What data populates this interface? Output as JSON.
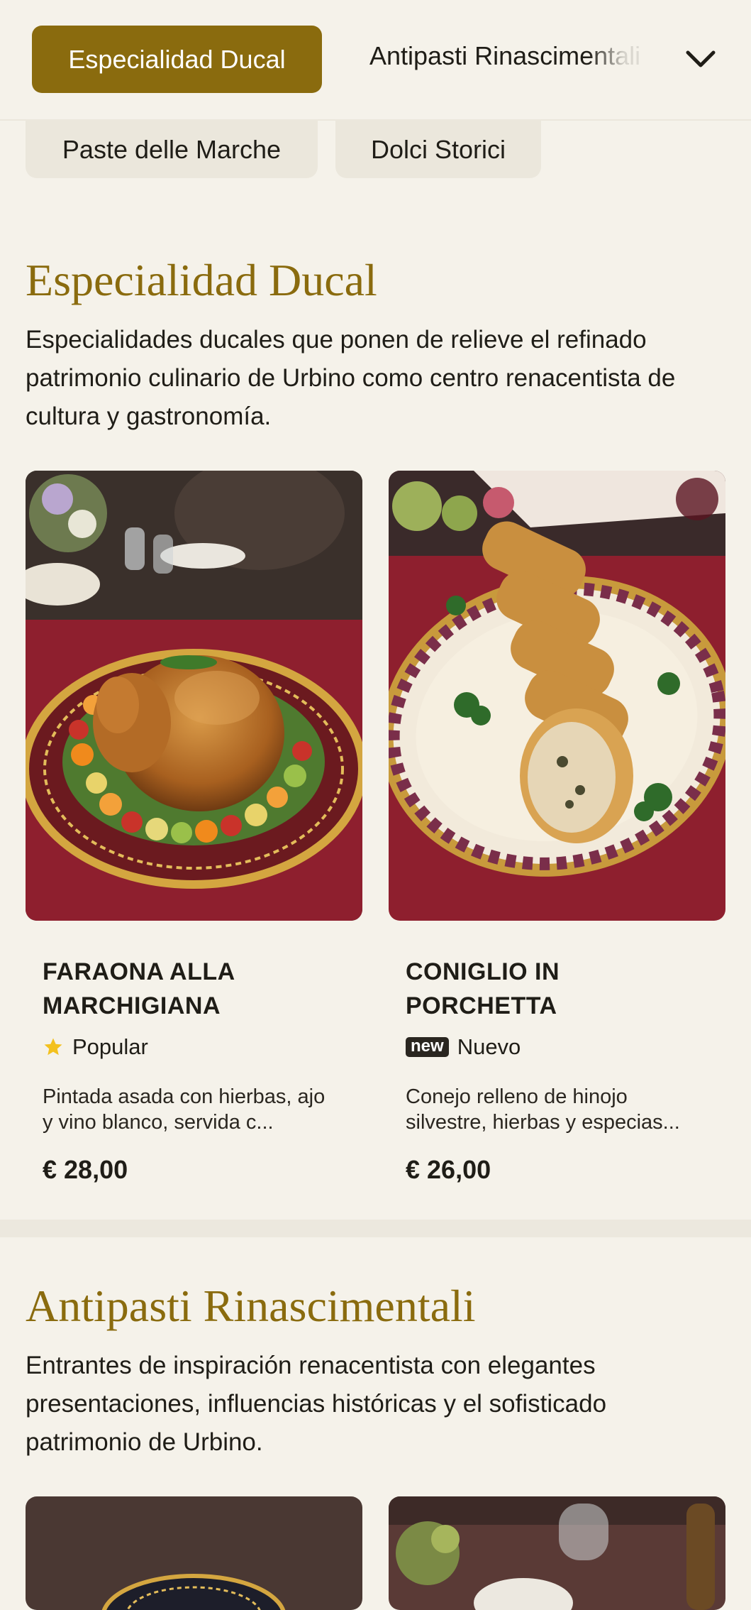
{
  "nav": {
    "active_category": "Especialidad Ducal",
    "next_category": "Antipasti Rinascimentali",
    "row2": [
      "Paste delle Marche",
      "Dolci Storici"
    ]
  },
  "sections": [
    {
      "title": "Especialidad Ducal",
      "description": "Especialidades ducales que ponen de relieve el refinado patrimonio culinario de Urbino como centro renacentista de cultura y gastronomía.",
      "items": [
        {
          "name": "FARAONA ALLA MARCHIGIANA",
          "badge": "Popular",
          "badge_icon": "star-icon",
          "description": "Pintada asada con hierbas, ajo y vino blanco, servida c...",
          "price": "€ 28,00"
        },
        {
          "name": "CONIGLIO IN PORCHETTA",
          "badge": "Nuevo",
          "badge_tag": "new",
          "description": "Conejo relleno de hinojo silvestre, hierbas y especias...",
          "price": "€ 26,00"
        }
      ]
    },
    {
      "title": "Antipasti Rinascimentali",
      "description": "Entrantes de inspiración renacentista con elegantes presentaciones, influencias históricas y el sofisticado patrimonio de Urbino."
    }
  ],
  "colors": {
    "accent": "#8a6b0e",
    "background": "#f5f2ea",
    "star": "#f3c11f",
    "tablecloth": "#8e1f2e"
  }
}
